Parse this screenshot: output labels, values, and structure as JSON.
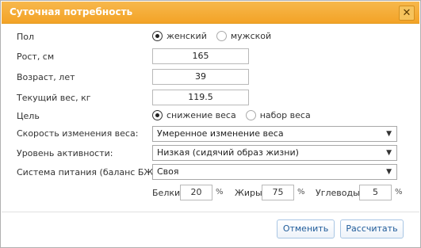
{
  "dialog": {
    "title": "Суточная потребность",
    "close_label": "✕"
  },
  "form": {
    "gender": {
      "label": "Пол",
      "options": [
        {
          "label": "женский",
          "checked": true
        },
        {
          "label": "мужской",
          "checked": false
        }
      ]
    },
    "height": {
      "label": "Рост, см",
      "value": "165"
    },
    "age": {
      "label": "Возраст, лет",
      "value": "39"
    },
    "weight": {
      "label": "Текущий вес, кг",
      "value": "119.5"
    },
    "goal": {
      "label": "Цель",
      "options": [
        {
          "label": "снижение веса",
          "checked": true
        },
        {
          "label": "набор веса",
          "checked": false
        }
      ]
    },
    "speed": {
      "label": "Скорость изменения веса:",
      "value": "Умеренное изменение веса"
    },
    "activity": {
      "label": "Уровень активности:",
      "value": "Низкая (сидячий образ жизни)"
    },
    "diet": {
      "label": "Система питания (баланс БЖУ):",
      "value": "Своя"
    },
    "macros": {
      "protein": {
        "label": "Белки",
        "value": "20",
        "unit": "%"
      },
      "fat": {
        "label": "Жиры",
        "value": "75",
        "unit": "%"
      },
      "carbs": {
        "label": "Углеводы",
        "value": "5",
        "unit": "%"
      }
    }
  },
  "buttons": {
    "cancel": "Отменить",
    "calculate": "Рассчитать"
  },
  "icons": {
    "close": "close-icon",
    "dropdown": "chevron-down-icon"
  },
  "colors": {
    "titlebar": "#f3a327",
    "button_text": "#1f5b99"
  }
}
